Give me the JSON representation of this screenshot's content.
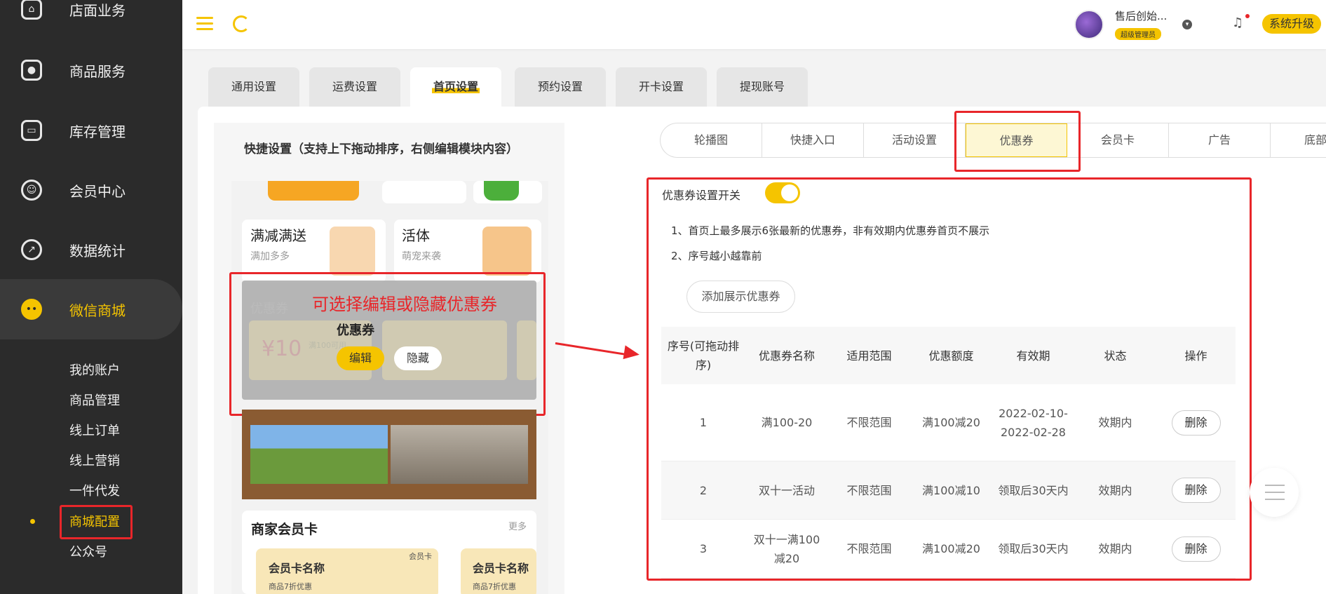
{
  "sidebar": {
    "items": [
      {
        "label": "店面业务",
        "icon": "home-icon"
      },
      {
        "label": "商品服务",
        "icon": "bag-icon"
      },
      {
        "label": "库存管理",
        "icon": "box-icon"
      },
      {
        "label": "会员中心",
        "icon": "member-icon"
      },
      {
        "label": "数据统计",
        "icon": "chart-icon"
      },
      {
        "label": "微信商城",
        "icon": "wechat-icon"
      }
    ],
    "sub_items": [
      "我的账户",
      "商品管理",
      "线上订单",
      "线上营销",
      "一件代发",
      "商城配置",
      "公众号"
    ]
  },
  "header": {
    "user_name": "售后创始...",
    "user_role": "超级管理员",
    "upgrade_label": "系统升级"
  },
  "tabs": [
    "通用设置",
    "运费设置",
    "首页设置",
    "预约设置",
    "开卡设置",
    "提现账号"
  ],
  "preview": {
    "title": "快捷设置（支持上下拖动排序，右侧编辑模块内容）",
    "card1_title": "满减满送",
    "card1_sub": "满加多多",
    "card2_title": "活体",
    "card2_sub": "萌宠来袭",
    "coupon_faded": "优惠券",
    "coupon_label": "优惠券",
    "coupon_value": "¥10",
    "coupon_cond": "满100可用",
    "edit_label": "编辑",
    "hide_label": "隐藏",
    "member_title": "商家会员卡",
    "more_label": "更多",
    "mcard_tag": "会员卡",
    "mcard_name": "会员卡名称",
    "mcard_desc": "商品7折优惠"
  },
  "annotation": "可选择编辑或隐藏优惠券",
  "subtabs": [
    "轮播图",
    "快捷入口",
    "活动设置",
    "优惠券",
    "会员卡",
    "广告",
    "底部导"
  ],
  "coupon_panel": {
    "switch_label": "优惠券设置开关",
    "switch_on": true,
    "notes": [
      "1、首页上最多展示6张最新的优惠券，非有效期内优惠券首页不展示",
      "2、序号越小越靠前"
    ],
    "add_button": "添加展示优惠券"
  },
  "table": {
    "headers": [
      "序号(可拖动排序)",
      "优惠券名称",
      "适用范围",
      "优惠额度",
      "有效期",
      "状态",
      "操作"
    ],
    "rows": [
      {
        "no": "1",
        "name": "满100-20",
        "scope": "不限范围",
        "amount": "满100减20",
        "valid": "2022-02-10-2022-02-28",
        "status": "效期内",
        "action": "删除"
      },
      {
        "no": "2",
        "name": "双十一活动",
        "scope": "不限范围",
        "amount": "满100减10",
        "valid": "领取后30天内",
        "status": "效期内",
        "action": "删除"
      },
      {
        "no": "3",
        "name": "双十一满100减20",
        "scope": "不限范围",
        "amount": "满100减20",
        "valid": "领取后30天内",
        "status": "效期内",
        "action": "删除"
      }
    ]
  },
  "colors": {
    "accent": "#f5c400",
    "sidebar_bg": "#2b2b2b",
    "annotation": "#e8262a"
  }
}
